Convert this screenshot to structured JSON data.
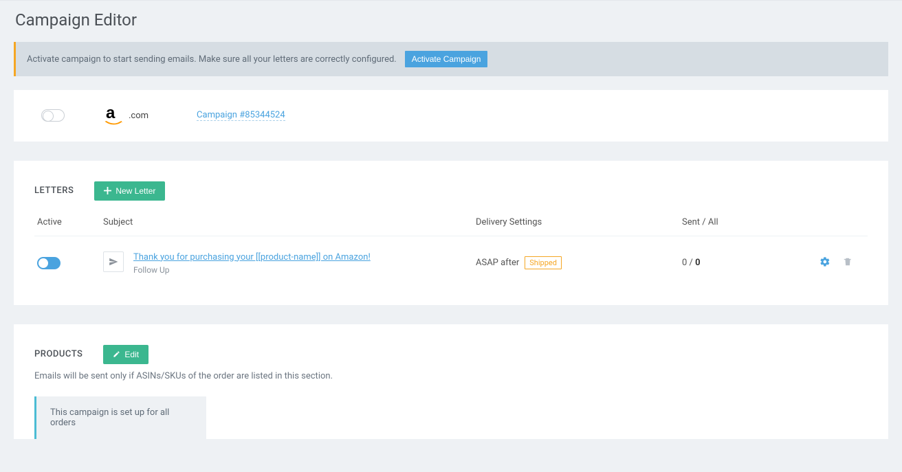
{
  "page_title": "Campaign Editor",
  "alert": {
    "text": "Activate campaign to start sending emails. Make sure all your letters are correctly configured.",
    "button": "Activate Campaign"
  },
  "campaign": {
    "domain": ".com",
    "link_text": "Campaign #85344524"
  },
  "letters": {
    "title": "LETTERS",
    "new_button": "New Letter",
    "columns": {
      "active": "Active",
      "subject": "Subject",
      "delivery": "Delivery Settings",
      "sent": "Sent / All"
    },
    "rows": [
      {
        "subject": "Thank you for purchasing your [[product-name]] on Amazon!",
        "subtype": "Follow Up",
        "delivery_prefix": "ASAP after",
        "delivery_badge": "Shipped",
        "sent": "0",
        "sep": " / ",
        "all": "0"
      }
    ]
  },
  "products": {
    "title": "PRODUCTS",
    "edit_button": "Edit",
    "note": "Emails will be sent only if ASINs/SKUs of the order are listed in this section.",
    "info": "This campaign is set up for all orders"
  }
}
